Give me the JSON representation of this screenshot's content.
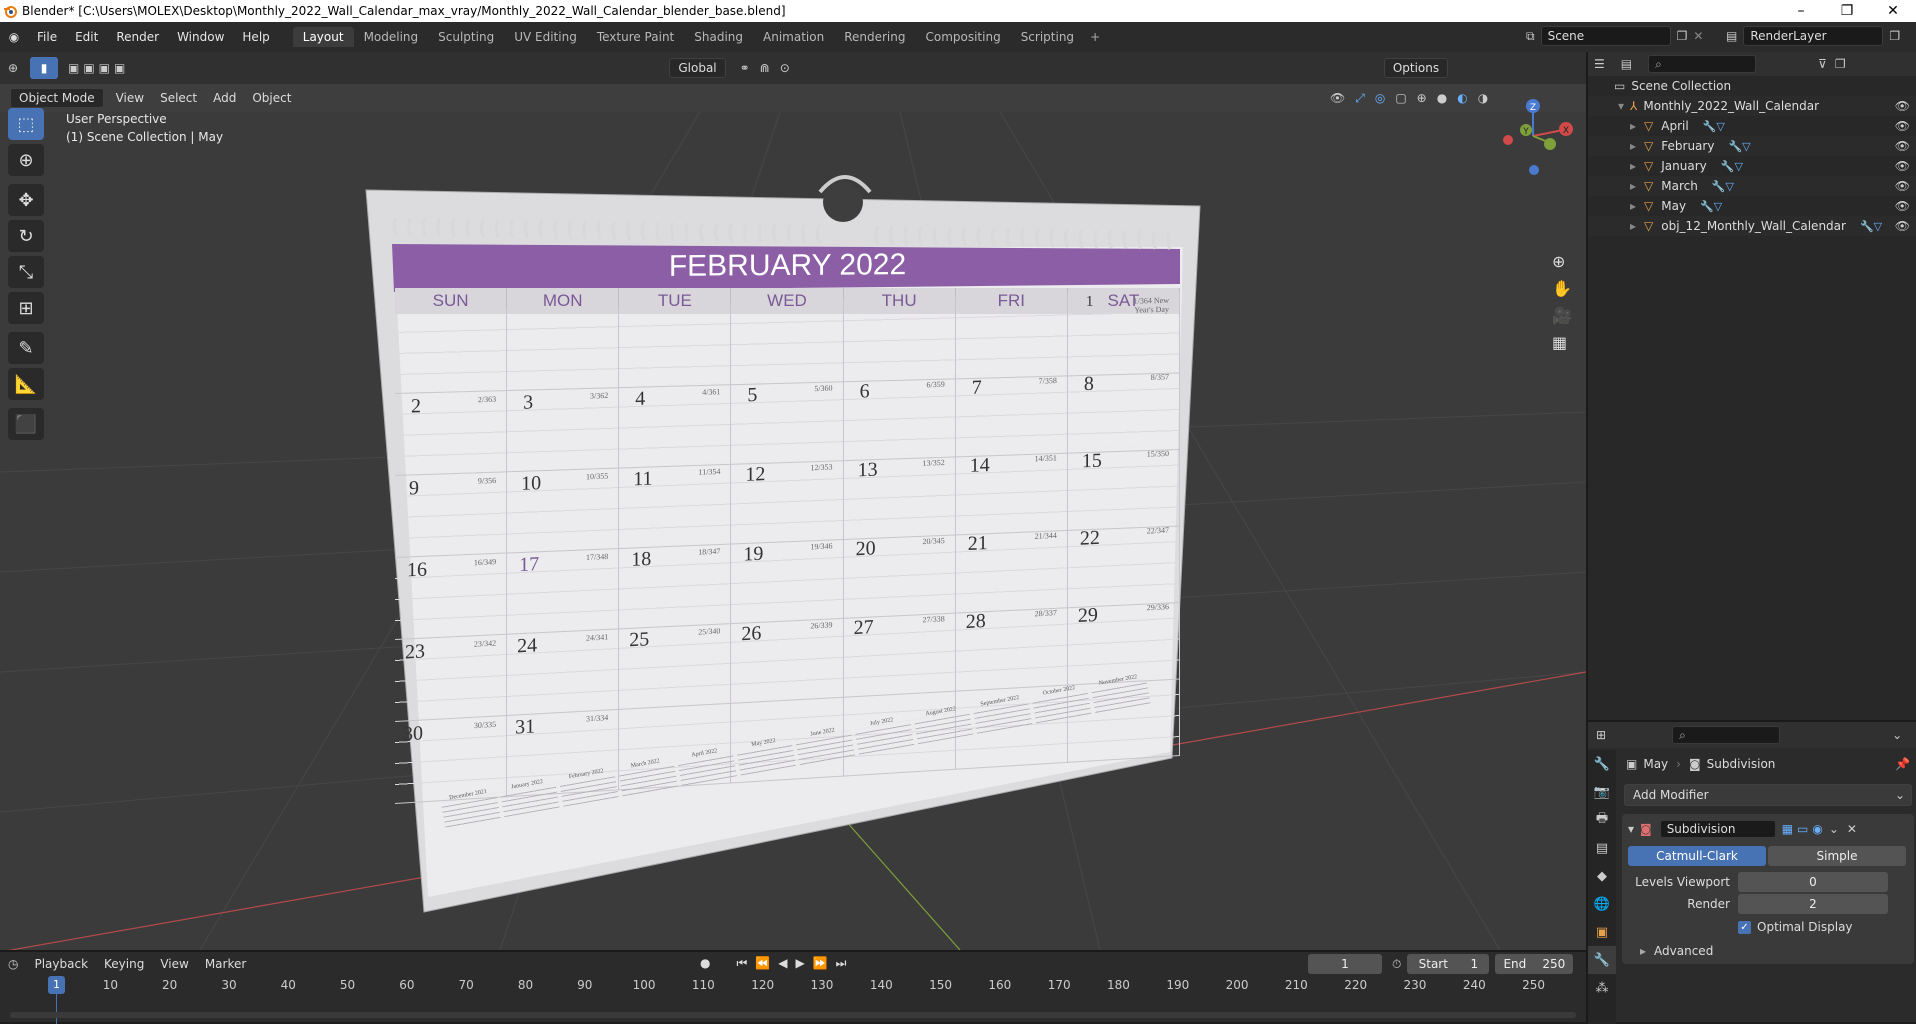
{
  "window": {
    "title": "Blender* [C:\\Users\\MOLEX\\Desktop\\Monthly_2022_Wall_Calendar_max_vray/Monthly_2022_Wall_Calendar_blender_base.blend]",
    "controls": [
      "–",
      "❐",
      "✕"
    ]
  },
  "menu": [
    "File",
    "Edit",
    "Render",
    "Window",
    "Help"
  ],
  "workspaces": [
    "Layout",
    "Modeling",
    "Sculpting",
    "UV Editing",
    "Texture Paint",
    "Shading",
    "Animation",
    "Rendering",
    "Compositing",
    "Scripting"
  ],
  "active_workspace": "Layout",
  "scene": {
    "name": "Scene",
    "view_layer": "RenderLayer"
  },
  "viewport_header": {
    "mode": "Object Mode",
    "menus": [
      "View",
      "Select",
      "Add",
      "Object"
    ],
    "transform": "Global",
    "options": "Options"
  },
  "viewport_info": {
    "line1": "User Perspective",
    "line2": "(1) Scene Collection | May"
  },
  "gizmo": {
    "z": "Z",
    "y": "Y",
    "x": "X"
  },
  "calendar": {
    "title": "FEBRUARY 2022",
    "days": [
      "SUN",
      "MON",
      "TUE",
      "WED",
      "THU",
      "FRI",
      "SAT"
    ],
    "rows": [
      [
        {
          "d": "",
          "s": ""
        },
        {
          "d": "",
          "s": ""
        },
        {
          "d": "",
          "s": ""
        },
        {
          "d": "",
          "s": ""
        },
        {
          "d": "",
          "s": ""
        },
        {
          "d": "",
          "s": ""
        },
        {
          "d": "1",
          "s": "1/364 New Year's Day"
        }
      ],
      [
        {
          "d": "2",
          "s": "2/363"
        },
        {
          "d": "3",
          "s": "3/362"
        },
        {
          "d": "4",
          "s": "4/361"
        },
        {
          "d": "5",
          "s": "5/360"
        },
        {
          "d": "6",
          "s": "6/359"
        },
        {
          "d": "7",
          "s": "7/358"
        },
        {
          "d": "8",
          "s": "8/357"
        }
      ],
      [
        {
          "d": "9",
          "s": "9/356"
        },
        {
          "d": "10",
          "s": "10/355"
        },
        {
          "d": "11",
          "s": "11/354"
        },
        {
          "d": "12",
          "s": "12/353"
        },
        {
          "d": "13",
          "s": "13/352"
        },
        {
          "d": "14",
          "s": "14/351"
        },
        {
          "d": "15",
          "s": "15/350"
        }
      ],
      [
        {
          "d": "16",
          "s": "16/349"
        },
        {
          "d": "17",
          "s": "17/348"
        },
        {
          "d": "18",
          "s": "18/347"
        },
        {
          "d": "19",
          "s": "19/346"
        },
        {
          "d": "20",
          "s": "20/345"
        },
        {
          "d": "21",
          "s": "21/344"
        },
        {
          "d": "22",
          "s": "22/347"
        }
      ],
      [
        {
          "d": "23",
          "s": "23/342"
        },
        {
          "d": "24",
          "s": "24/341"
        },
        {
          "d": "25",
          "s": "25/340"
        },
        {
          "d": "26",
          "s": "26/339"
        },
        {
          "d": "27",
          "s": "27/338"
        },
        {
          "d": "28",
          "s": "28/337"
        },
        {
          "d": "29",
          "s": "29/336"
        }
      ],
      [
        {
          "d": "30",
          "s": "30/335"
        },
        {
          "d": "31",
          "s": "31/334"
        },
        {
          "d": "",
          "s": ""
        },
        {
          "d": "",
          "s": ""
        },
        {
          "d": "",
          "s": ""
        },
        {
          "d": "",
          "s": ""
        },
        {
          "d": "",
          "s": ""
        }
      ]
    ],
    "mini_months": [
      "December 2021",
      "January 2022",
      "February 2022",
      "March 2022",
      "April 2022",
      "May 2022",
      "June 2022",
      "July 2022",
      "August 2022",
      "September 2022",
      "October 2022",
      "November 2022"
    ]
  },
  "outliner": {
    "root": "Scene Collection",
    "collection": "Monthly_2022_Wall_Calendar",
    "items": [
      "April",
      "February",
      "January",
      "March",
      "May",
      "obj_12_Monthly_Wall_Calendar"
    ]
  },
  "properties": {
    "object": "May",
    "modifier_path": "Subdivision",
    "add_modifier": "Add Modifier",
    "modifier_name": "Subdivision",
    "types": [
      "Catmull-Clark",
      "Simple"
    ],
    "levels_viewport_label": "Levels Viewport",
    "levels_viewport": "0",
    "render_label": "Render",
    "render": "2",
    "optimal_display": "Optimal Display",
    "advanced": "Advanced"
  },
  "timeline": {
    "menus": [
      "Playback",
      "Keying",
      "View",
      "Marker"
    ],
    "current_frame": "1",
    "start_label": "Start",
    "start": "1",
    "end_label": "End",
    "end": "250",
    "ticks": [
      "1",
      "10",
      "20",
      "30",
      "40",
      "50",
      "60",
      "70",
      "80",
      "90",
      "100",
      "110",
      "120",
      "130",
      "140",
      "150",
      "160",
      "170",
      "180",
      "190",
      "200",
      "210",
      "220",
      "230",
      "240",
      "250"
    ]
  },
  "colors": {
    "accent": "#4772b3",
    "calendar_band": "#8b5ea6",
    "day_text": "#7a5a96",
    "x_axis": "#b34a4a",
    "y_axis": "#7ea03a"
  }
}
